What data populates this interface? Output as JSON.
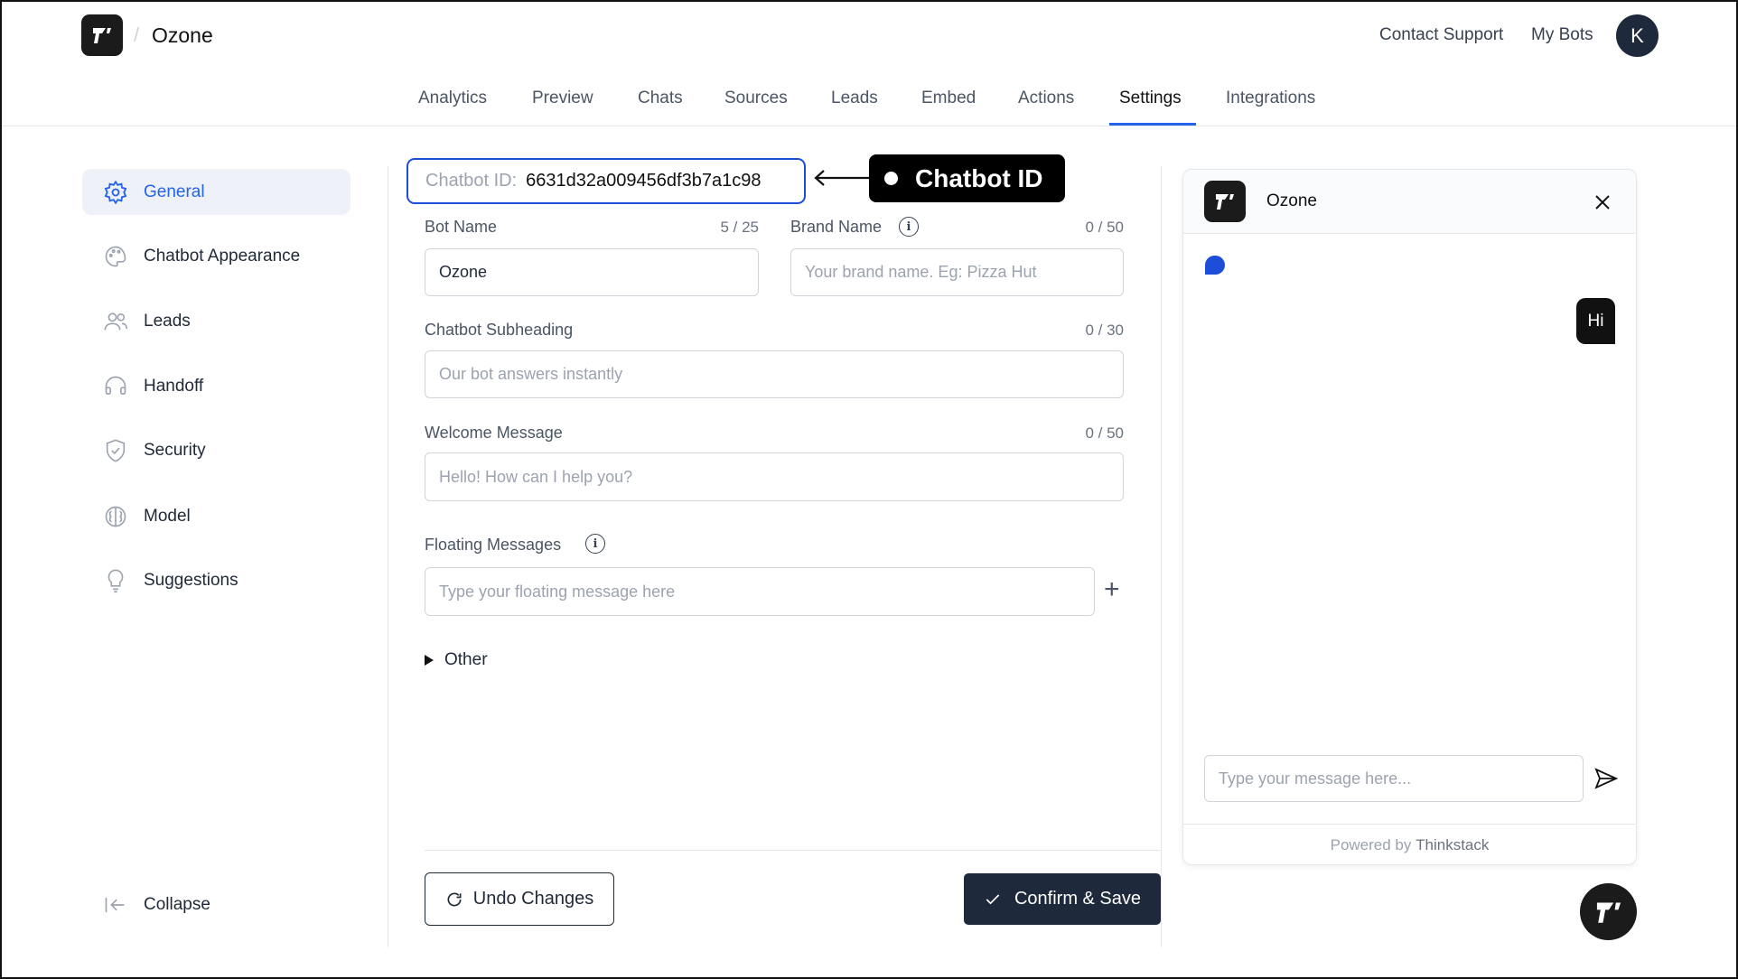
{
  "header": {
    "title": "Ozone",
    "separator": "/",
    "contact_support": "Contact Support",
    "my_bots": "My Bots",
    "avatar_initial": "K"
  },
  "tabs": [
    {
      "label": "Analytics"
    },
    {
      "label": "Preview"
    },
    {
      "label": "Chats"
    },
    {
      "label": "Sources"
    },
    {
      "label": "Leads"
    },
    {
      "label": "Embed"
    },
    {
      "label": "Actions"
    },
    {
      "label": "Settings",
      "active": true
    },
    {
      "label": "Integrations"
    }
  ],
  "sidebar": {
    "items": [
      {
        "label": "General",
        "icon": "gear-icon",
        "active": true
      },
      {
        "label": "Chatbot Appearance",
        "icon": "palette-icon"
      },
      {
        "label": "Leads",
        "icon": "users-icon"
      },
      {
        "label": "Handoff",
        "icon": "headset-icon"
      },
      {
        "label": "Security",
        "icon": "shield-icon"
      },
      {
        "label": "Model",
        "icon": "brain-icon"
      },
      {
        "label": "Suggestions",
        "icon": "lightbulb-icon"
      }
    ],
    "collapse": "Collapse"
  },
  "form": {
    "chatbot_id_label": "Chatbot ID:",
    "chatbot_id": "6631d32a009456df3b7a1c98",
    "annotation": "Chatbot ID",
    "bot_name": {
      "label": "Bot Name",
      "count": "5 / 25",
      "value": "Ozone"
    },
    "brand_name": {
      "label": "Brand Name",
      "count": "0 / 50",
      "placeholder": "Your brand name. Eg: Pizza Hut"
    },
    "subheading": {
      "label": "Chatbot Subheading",
      "count": "0 / 30",
      "placeholder": "Our bot answers instantly"
    },
    "welcome": {
      "label": "Welcome Message",
      "count": "0 / 50",
      "placeholder": "Hello! How can I help you?"
    },
    "floating": {
      "label": "Floating Messages",
      "placeholder": "Type your floating message here"
    },
    "other": "Other",
    "undo": "Undo Changes",
    "confirm": "Confirm & Save"
  },
  "preview": {
    "title": "Ozone",
    "user_message": "Hi",
    "input_placeholder": "Type your message here...",
    "powered_prefix": "Powered by",
    "powered_brand": "Thinkstack"
  },
  "colors": {
    "accent": "#2563eb",
    "primary_button": "#1e293b",
    "bubble_dot": "#1d4ed8"
  }
}
